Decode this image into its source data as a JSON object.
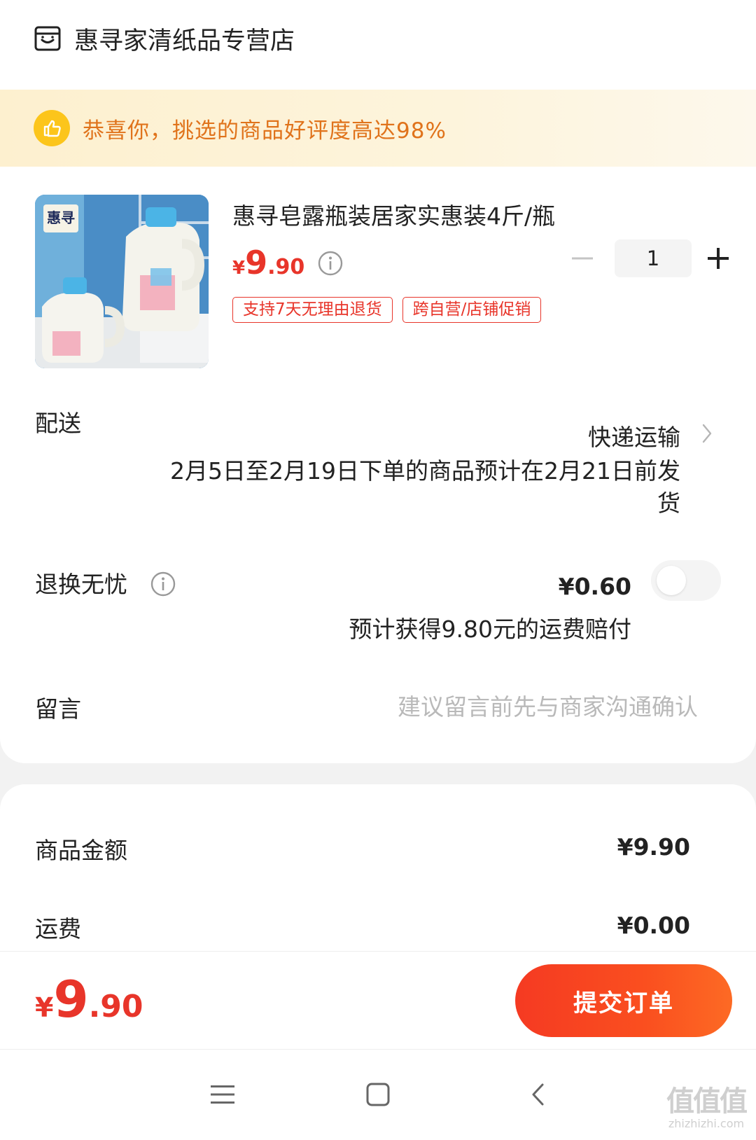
{
  "store": {
    "name": "惠寻家清纸品专营店",
    "icon": "store-icon"
  },
  "banner": {
    "text": "恭喜你，挑选的商品好评度高达98%",
    "icon": "thumbs-up-icon"
  },
  "product": {
    "title": "惠寻皂露瓶装居家实惠装4斤/瓶",
    "price": {
      "currency": "¥",
      "integer": "9",
      "decimal": ".90"
    },
    "quantity": "1",
    "tags": [
      "支持7天无理由退货",
      "跨自营/店铺促销"
    ],
    "image_brand": "惠寻"
  },
  "delivery": {
    "label": "配送",
    "method": "快递运输",
    "note": "2月5日至2月19日下单的商品预计在2月21日前发货"
  },
  "return_insurance": {
    "label": "退换无忧",
    "price": "¥0.60",
    "note": "预计获得9.80元的运费赔付",
    "enabled": false
  },
  "message": {
    "label": "留言",
    "placeholder": "建议留言前先与商家沟通确认",
    "value": ""
  },
  "summary": {
    "goods_label": "商品金额",
    "goods_value": "¥9.90",
    "shipping_label": "运费",
    "shipping_value": "¥0.00"
  },
  "footer": {
    "total": {
      "currency": "¥",
      "integer": "9",
      "decimal": ".90"
    },
    "submit_label": "提交订单"
  },
  "watermark": {
    "main": "值值值",
    "sub": "zhizhizhi.com"
  },
  "colors": {
    "accent": "#e8352a",
    "banner_bg": "#fdf0cf",
    "banner_text": "#e0731b",
    "button_start": "#f53a22",
    "button_end": "#fd6a24",
    "thumb": "#fcc51b"
  }
}
